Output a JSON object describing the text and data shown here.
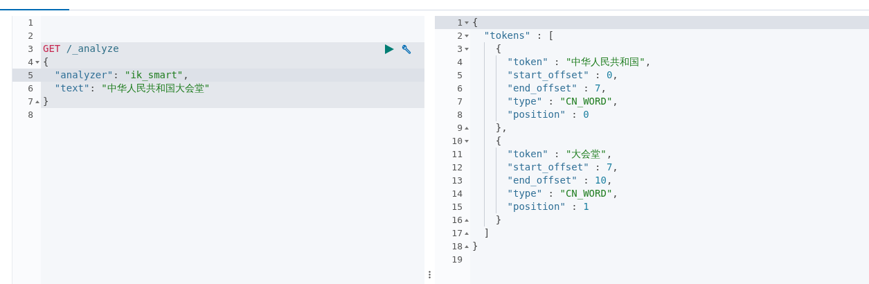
{
  "request_editor": {
    "lines": [
      {
        "number": "1",
        "kind": "plain",
        "active": false
      },
      {
        "number": "2",
        "kind": "plain",
        "active": false
      },
      {
        "kind": "request",
        "highlighted": true,
        "lines": [
          {
            "number": "3",
            "kind": "plain",
            "active": false,
            "segments": [
              {
                "kind": "method",
                "text": "GET"
              },
              {
                "kind": "path",
                "text": " /_analyze"
              }
            ]
          },
          {
            "number": "4",
            "kind": "fold_start",
            "active": false,
            "segments": [
              {
                "kind": "punct",
                "text": "{"
              }
            ]
          },
          {
            "number": "5",
            "kind": "plain",
            "active": true,
            "segments": [
              {
                "kind": "key",
                "text": "  \"analyzer\""
              },
              {
                "kind": "punct",
                "text": ": "
              },
              {
                "kind": "string",
                "text": "\"ik_smart\""
              },
              {
                "kind": "punct",
                "text": ","
              }
            ]
          },
          {
            "number": "6",
            "kind": "plain",
            "active": false,
            "segments": [
              {
                "kind": "key",
                "text": "  \"text\""
              },
              {
                "kind": "punct",
                "text": ": "
              },
              {
                "kind": "string",
                "text": "\"中华人民共和国大会堂\""
              }
            ]
          },
          {
            "number": "7",
            "kind": "fold_end",
            "active": false,
            "segments": [
              {
                "kind": "punct",
                "text": "}"
              }
            ]
          }
        ]
      },
      {
        "number": "8",
        "kind": "plain",
        "active": false
      }
    ]
  },
  "response_viewer": {
    "lines": [
      {
        "number": "1",
        "kind": "fold_start",
        "active": true,
        "segments": [
          {
            "kind": "punct",
            "text": "{"
          }
        ]
      },
      {
        "number": "2",
        "kind": "fold_start",
        "active": false,
        "segments": [
          {
            "kind": "key",
            "text": "  \"tokens\""
          },
          {
            "kind": "punct",
            "text": " : ["
          }
        ]
      },
      {
        "number": "3",
        "kind": "fold_start",
        "active": false,
        "segments": [
          {
            "kind": "punct",
            "text": "    {"
          }
        ]
      },
      {
        "number": "4",
        "kind": "plain",
        "active": false,
        "segments": [
          {
            "kind": "key",
            "text": "      \"token\""
          },
          {
            "kind": "punct",
            "text": " : "
          },
          {
            "kind": "string",
            "text": "\"中华人民共和国\""
          },
          {
            "kind": "punct",
            "text": ","
          }
        ]
      },
      {
        "number": "5",
        "kind": "plain",
        "active": false,
        "segments": [
          {
            "kind": "key",
            "text": "      \"start_offset\""
          },
          {
            "kind": "punct",
            "text": " : "
          },
          {
            "kind": "number",
            "text": "0"
          },
          {
            "kind": "punct",
            "text": ","
          }
        ]
      },
      {
        "number": "6",
        "kind": "plain",
        "active": false,
        "segments": [
          {
            "kind": "key",
            "text": "      \"end_offset\""
          },
          {
            "kind": "punct",
            "text": " : "
          },
          {
            "kind": "number",
            "text": "7"
          },
          {
            "kind": "punct",
            "text": ","
          }
        ]
      },
      {
        "number": "7",
        "kind": "plain",
        "active": false,
        "segments": [
          {
            "kind": "key",
            "text": "      \"type\""
          },
          {
            "kind": "punct",
            "text": " : "
          },
          {
            "kind": "string",
            "text": "\"CN_WORD\""
          },
          {
            "kind": "punct",
            "text": ","
          }
        ]
      },
      {
        "number": "8",
        "kind": "plain",
        "active": false,
        "segments": [
          {
            "kind": "key",
            "text": "      \"position\""
          },
          {
            "kind": "punct",
            "text": " : "
          },
          {
            "kind": "number",
            "text": "0"
          }
        ]
      },
      {
        "number": "9",
        "kind": "fold_end",
        "active": false,
        "segments": [
          {
            "kind": "punct",
            "text": "    },"
          }
        ]
      },
      {
        "number": "10",
        "kind": "fold_start",
        "active": false,
        "segments": [
          {
            "kind": "punct",
            "text": "    {"
          }
        ]
      },
      {
        "number": "11",
        "kind": "plain",
        "active": false,
        "segments": [
          {
            "kind": "key",
            "text": "      \"token\""
          },
          {
            "kind": "punct",
            "text": " : "
          },
          {
            "kind": "string",
            "text": "\"大会堂\""
          },
          {
            "kind": "punct",
            "text": ","
          }
        ]
      },
      {
        "number": "12",
        "kind": "plain",
        "active": false,
        "segments": [
          {
            "kind": "key",
            "text": "      \"start_offset\""
          },
          {
            "kind": "punct",
            "text": " : "
          },
          {
            "kind": "number",
            "text": "7"
          },
          {
            "kind": "punct",
            "text": ","
          }
        ]
      },
      {
        "number": "13",
        "kind": "plain",
        "active": false,
        "segments": [
          {
            "kind": "key",
            "text": "      \"end_offset\""
          },
          {
            "kind": "punct",
            "text": " : "
          },
          {
            "kind": "number",
            "text": "10"
          },
          {
            "kind": "punct",
            "text": ","
          }
        ]
      },
      {
        "number": "14",
        "kind": "plain",
        "active": false,
        "segments": [
          {
            "kind": "key",
            "text": "      \"type\""
          },
          {
            "kind": "punct",
            "text": " : "
          },
          {
            "kind": "string",
            "text": "\"CN_WORD\""
          },
          {
            "kind": "punct",
            "text": ","
          }
        ]
      },
      {
        "number": "15",
        "kind": "plain",
        "active": false,
        "segments": [
          {
            "kind": "key",
            "text": "      \"position\""
          },
          {
            "kind": "punct",
            "text": " : "
          },
          {
            "kind": "number",
            "text": "1"
          }
        ]
      },
      {
        "number": "16",
        "kind": "fold_end",
        "active": false,
        "segments": [
          {
            "kind": "punct",
            "text": "    }"
          }
        ]
      },
      {
        "number": "17",
        "kind": "fold_end",
        "active": false,
        "segments": [
          {
            "kind": "punct",
            "text": "  ]"
          }
        ]
      },
      {
        "number": "18",
        "kind": "fold_end",
        "active": false,
        "segments": [
          {
            "kind": "punct",
            "text": "}"
          }
        ]
      },
      {
        "number": "19",
        "kind": "plain",
        "active": false
      }
    ]
  }
}
